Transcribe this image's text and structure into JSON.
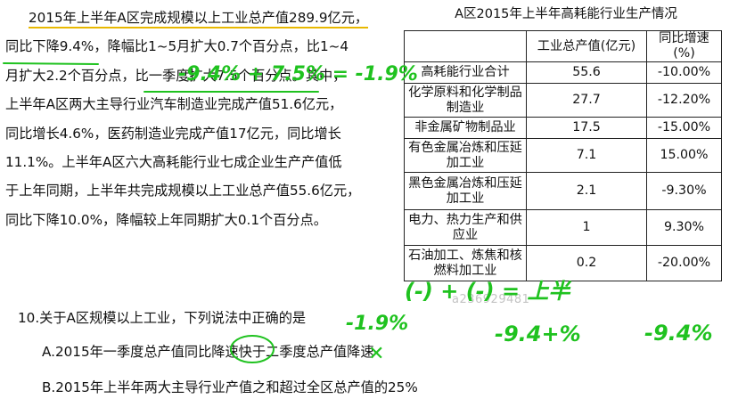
{
  "passage": {
    "lines": [
      "2015年上半年A区完成规模以上工业总产值289.9亿元，",
      "同比下降9.4%，降幅比1~5月扩大0.7个百分点，比1~4",
      "月扩大2.2个百分点，比一季度扩大7.5个百分点。其中，",
      "上半年A区两大主导行业汽车制造业完成产值51.6亿元，",
      "同比增长4.6%，医药制造业完成产值17亿元，同比增长",
      "11.1%。上半年A区六大高耗能行业七成企业生产产值低",
      "于上年同期，上半年共完成规模以上工业总产值55.6亿元，",
      "同比下降10.0%，降幅较上年同期扩大0.1个百分点。"
    ]
  },
  "table": {
    "title": "A区2015年上半年高耗能行业生产情况",
    "headers": [
      "",
      "工业总产值(亿元)",
      "同比增速(%)"
    ],
    "rows": [
      {
        "name": "高耗能行业合计",
        "value": "55.6",
        "growth": "-10.00%"
      },
      {
        "name": "化学原料和化学制品制造业",
        "value": "27.7",
        "growth": "-12.20%"
      },
      {
        "name": "非金属矿物制品业",
        "value": "17.5",
        "growth": "-15.00%"
      },
      {
        "name": "有色金属冶炼和压延加工业",
        "value": "7.1",
        "growth": "15.00%"
      },
      {
        "name": "黑色金属冶炼和压延加工业",
        "value": "2.1",
        "growth": "-9.30%"
      },
      {
        "name": "电力、热力生产和供应业",
        "value": "1",
        "growth": "9.30%"
      },
      {
        "name": "石油加工、炼焦和核燃料加工业",
        "value": "0.2",
        "growth": "-20.00%"
      }
    ]
  },
  "question": {
    "stem": "10.关于A区规模以上工业，下列说法中正确的是",
    "option_a": "A.2015年一季度总产值同比降速快于二季度总产值降速",
    "option_b": "B.2015年上半年两大主导行业产值之和超过全区总产值的25%"
  },
  "watermark": "a236929481",
  "annotations": {
    "ink_color": "#1fc21f",
    "handwriting": [
      "-9.4% + 7.5% = -1.9%",
      "(-) + (-) = 上半",
      "-1.9%",
      "-9.4+%",
      "-9.4%",
      "✕"
    ]
  }
}
